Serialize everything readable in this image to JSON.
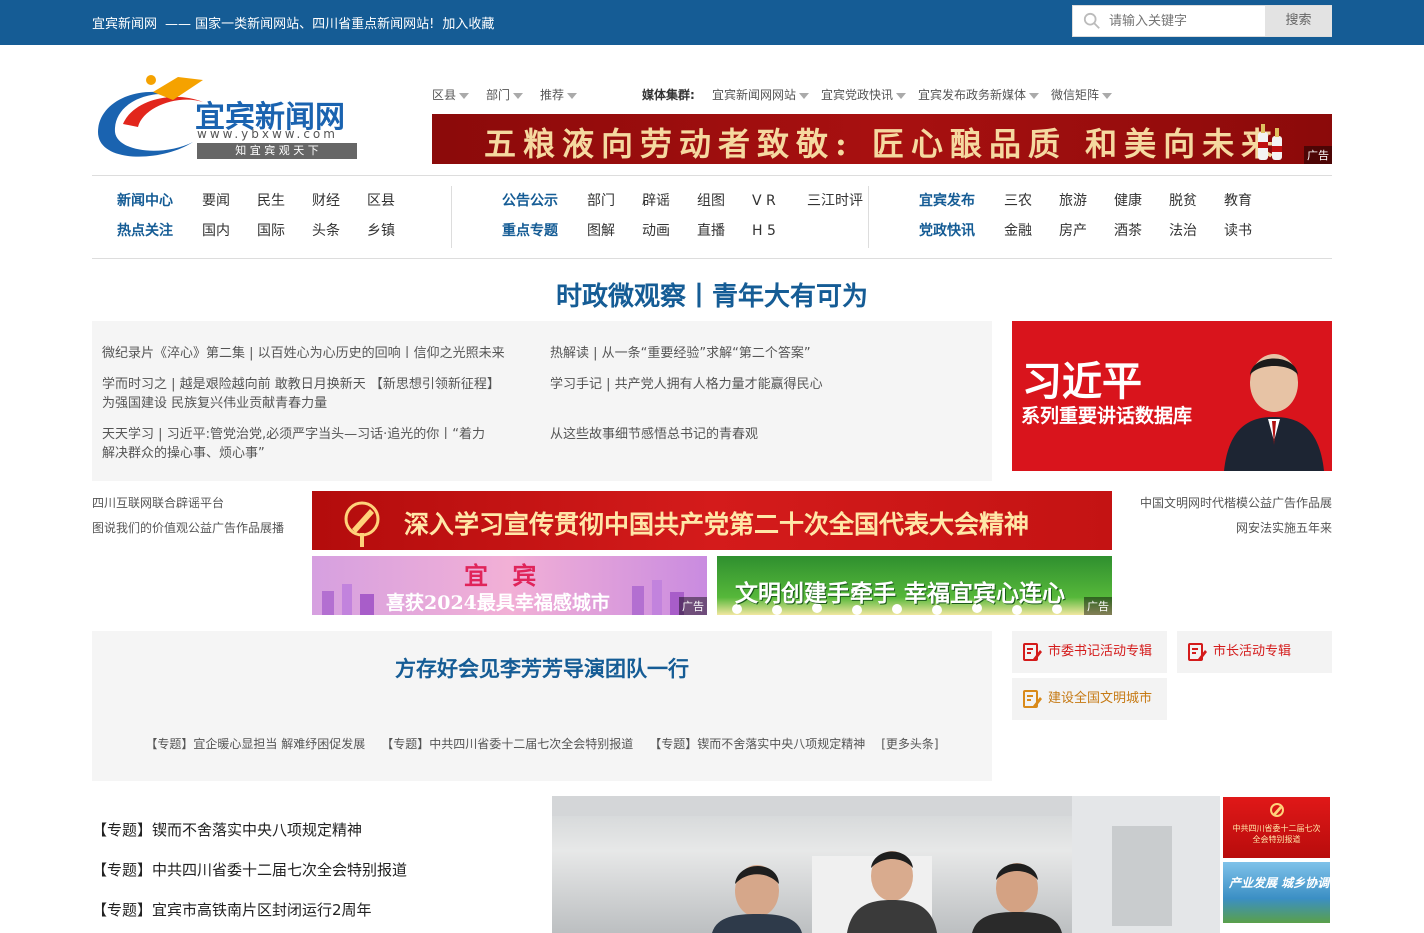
{
  "topbar": {
    "site_name": "宜宾新闻网",
    "slogan": "—— 国家一类新闻网站、四川省重点新闻网站!",
    "bookmark": "加入收藏",
    "search_placeholder": "请输入关键字",
    "search_button": "搜索"
  },
  "logo": {
    "title": "宜宾新闻网",
    "url_text": "www.ybxww.com",
    "motto": "知 宜 宾   观 天 下"
  },
  "subnav": {
    "items": [
      "区县",
      "部门",
      "推荐"
    ],
    "media_label": "媒体集群:",
    "media": [
      "宜宾新闻网网站",
      "宜宾党政快讯",
      "宜宾发布政务新媒体",
      "微信矩阵"
    ]
  },
  "banner1": {
    "text": "五粮液向劳动者致敬: 匠心酿品质 和美向未来",
    "ad": "广告"
  },
  "mainnav": {
    "g1": {
      "r1": [
        "新闻中心",
        "要闻",
        "民生",
        "财经",
        "区县"
      ],
      "r2": [
        "热点关注",
        "国内",
        "国际",
        "头条",
        "乡镇"
      ]
    },
    "g2": {
      "r1": [
        "公告公示",
        "部门",
        "辟谣",
        "组图",
        "V R",
        "三江时评"
      ],
      "r2": [
        "重点专题",
        "图解",
        "动画",
        "直播",
        "H 5"
      ]
    },
    "g3": {
      "r1": [
        "宜宾发布",
        "三农",
        "旅游",
        "健康",
        "脱贫",
        "教育"
      ],
      "r2": [
        "党政快讯",
        "金融",
        "房产",
        "酒茶",
        "法治",
        "读书"
      ]
    }
  },
  "headline": "时政微观察丨青年大有可为",
  "news": [
    "微纪录片《淬心》第二集 | 以百姓心为心历史的回响丨信仰之光照未来",
    "热解读 | 从一条“重要经验”求解“第二个答案”",
    "学而时习之 | 越是艰险越向前 敢教日月换新天 【新思想引领新征程】",
    "为强国建设 民族复兴伟业贡献青春力量",
    "学习手记 | 共产党人拥有人格力量才能赢得民心",
    "天天学习 | 习近平:管党治党,必须严字当头—习话·追光的你丨“着力",
    "解决群众的操心事、烦心事”",
    "从这些故事细节感悟总书记的青春观"
  ],
  "xjp": {
    "title": "习近平",
    "subtitle": "系列重要讲话数据库"
  },
  "left_links": [
    "四川互联网联合辟谣平台",
    "图说我们的价值观公益广告作品展播"
  ],
  "right_links": [
    "中国文明网时代楷模公益广告作品展",
    "网安法实施五年来"
  ],
  "banner2": {
    "text": "深入学习宣传贯彻中国共产党第二十次全国代表大会精神"
  },
  "banner3": {
    "title": "宜 宾",
    "subtitle": "喜获2024最具幸福感城市",
    "ad": "广告"
  },
  "banner4": {
    "text": "文明创建手牵手 幸福宜宾心连心",
    "ad": "广告"
  },
  "topnews": {
    "title": "方存好会见李芳芳导演团队一行",
    "links": [
      "【专题】宜企暖心显担当 解难纾困促发展",
      "【专题】中共四川省委十二届七次全会特别报道",
      "【专题】锲而不舍落实中央八项规定精神",
      "[更多头条]"
    ]
  },
  "special_buttons": [
    "市委书记活动专辑",
    "市长活动专辑",
    "建设全国文明城市"
  ],
  "special_list": [
    "【专题】锲而不舍落实中央八项规定精神",
    "【专题】中共四川省委十二届七次全会特别报道",
    "【专题】宜宾市高铁南片区封闭运行2周年"
  ],
  "thumbs": {
    "t1": "中共四川省委十二届七次全会特别报道",
    "t2": "产业发展 城乡协调"
  }
}
